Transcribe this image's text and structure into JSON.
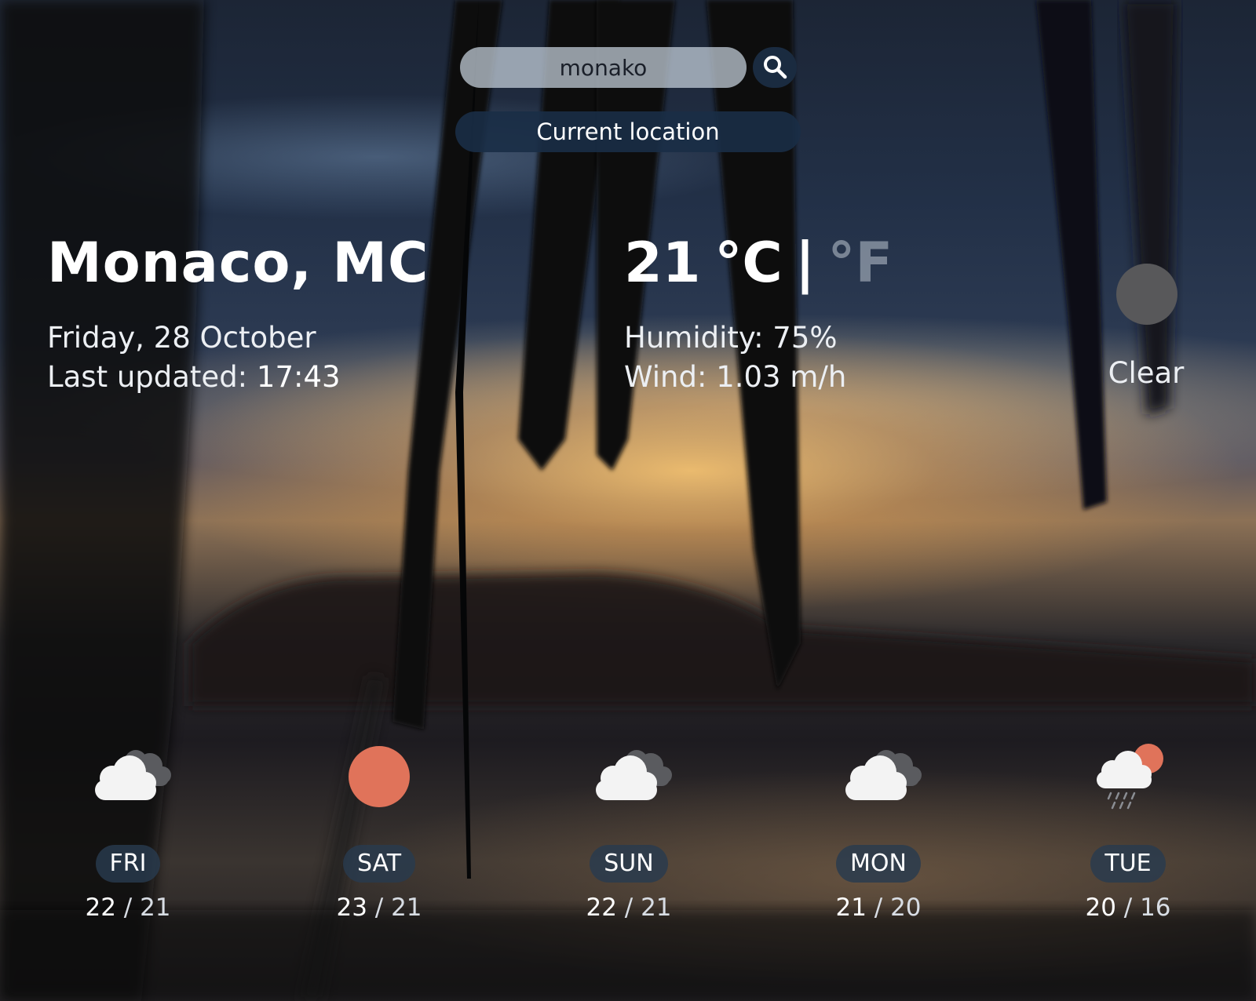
{
  "search": {
    "value": "monako",
    "placeholder": ""
  },
  "location_button_label": "Current location",
  "current": {
    "city": "Monaco, MC",
    "date": "Friday, 28 October",
    "updated_label": "Last updated: ",
    "updated_time": "17:43",
    "temp_value": "21",
    "unit_c": "°C",
    "separator": "|",
    "unit_f": "°F",
    "humidity": "Humidity: 75%",
    "wind": "Wind: 1.03 m/h",
    "condition": "Clear",
    "condition_icon": "clear-night-icon"
  },
  "forecast": [
    {
      "day": "FRI",
      "high": "22",
      "low": "21",
      "icon": "cloudy-icon"
    },
    {
      "day": "SAT",
      "high": "23",
      "low": "21",
      "icon": "sun-icon"
    },
    {
      "day": "SUN",
      "high": "22",
      "low": "21",
      "icon": "cloudy-icon"
    },
    {
      "day": "MON",
      "high": "21",
      "low": "20",
      "icon": "cloudy-icon"
    },
    {
      "day": "TUE",
      "high": "20",
      "low": "16",
      "icon": "rain-sun-icon"
    }
  ],
  "temp_separator": " / ",
  "colors": {
    "sun": "#e0735a",
    "cloud": "#f3f3f3",
    "cloud_dark": "#5a5b5f",
    "pill": "#283a4e",
    "accent": "#1a2b40"
  }
}
